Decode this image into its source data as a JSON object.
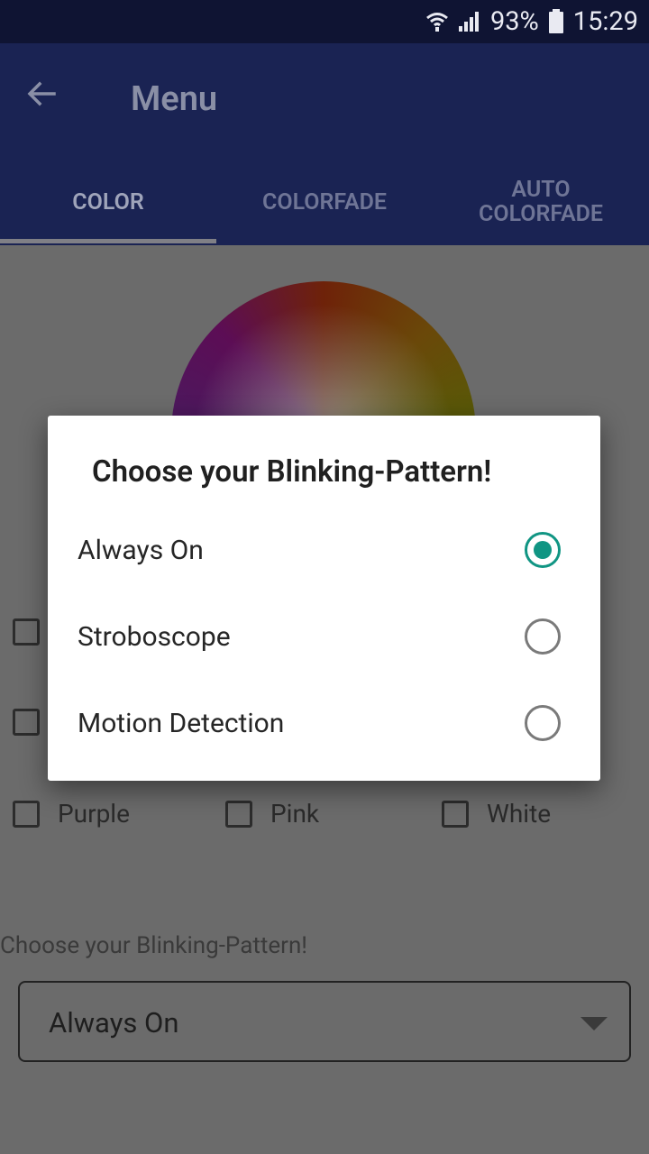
{
  "status": {
    "battery": "93%",
    "time": "15:29"
  },
  "appbar": {
    "title": "Menu"
  },
  "tabs": [
    {
      "label": "COLOR"
    },
    {
      "label": "COLORFADE"
    },
    {
      "label": "AUTO\nCOLORFADE"
    }
  ],
  "colors": {
    "row3": [
      "Purple",
      "Pink",
      "White"
    ]
  },
  "pattern": {
    "label": "Choose your Blinking-Pattern!",
    "selected": "Always On"
  },
  "dialog": {
    "title": "Choose your Blinking-Pattern!",
    "options": [
      {
        "label": "Always On",
        "checked": true
      },
      {
        "label": "Stroboscope",
        "checked": false
      },
      {
        "label": "Motion Detection",
        "checked": false
      }
    ]
  },
  "accent_color": "#109583"
}
